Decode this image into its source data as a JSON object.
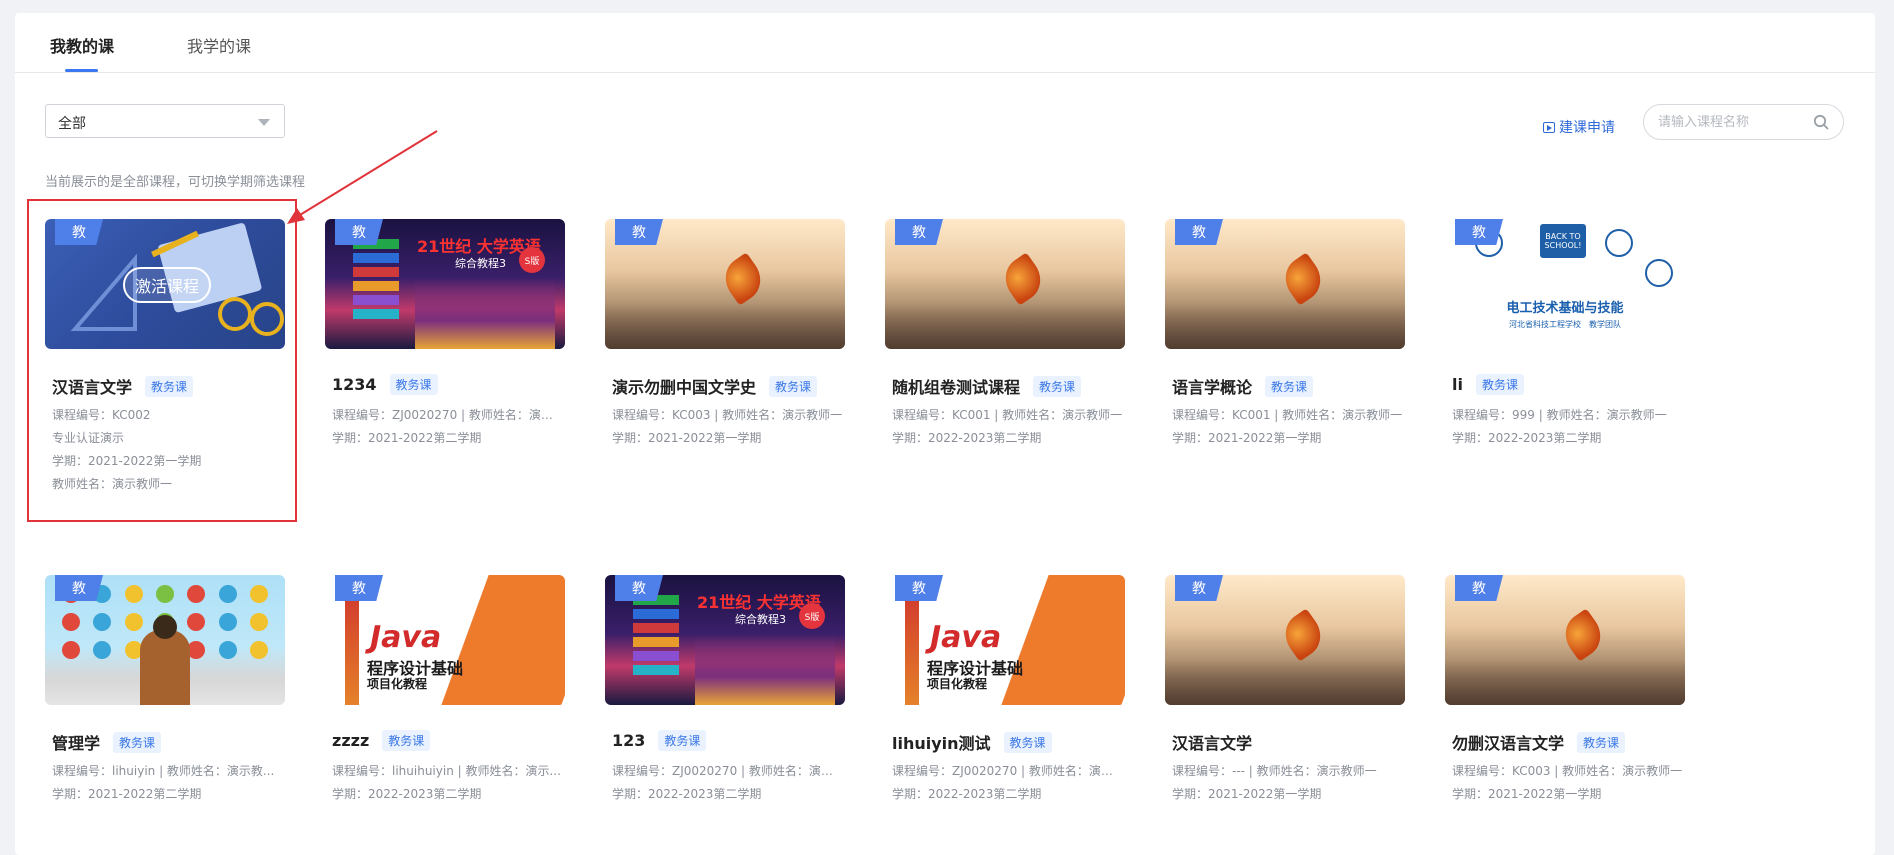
{
  "tabs": [
    {
      "label": "我教的课"
    },
    {
      "label": "我学的课"
    }
  ],
  "filter": {
    "selected": "全部"
  },
  "toolbar": {
    "apply_label": "建课申请"
  },
  "search": {
    "placeholder": "请输入课程名称"
  },
  "hint": "当前展示的是全部课程，可切换学期筛选课程",
  "badge_label": "教",
  "activate_label": "激活课程",
  "colors": {
    "accent": "#3a78f2",
    "badge": "#4f7fe8",
    "tag_text": "#3b78e7",
    "highlight": "#e0333a"
  },
  "courses": [
    {
      "title": "汉语言文学",
      "tag": "教务课",
      "cover": "blue",
      "meta": [
        "课程编号：KC002",
        "专业认证演示",
        "学期：2021-2022第一学期",
        "教师姓名：演示教师一"
      ]
    },
    {
      "title": "1234",
      "tag": "教务课",
      "cover": "city",
      "meta": [
        "课程编号：ZJ0020270 | 教师姓名：演示...",
        "学期：2021-2022第二学期"
      ]
    },
    {
      "title": "演示勿删中国文学史",
      "tag": "教务课",
      "cover": "leaf",
      "meta": [
        "课程编号：KC003 | 教师姓名：演示教师一",
        "学期：2021-2022第一学期"
      ]
    },
    {
      "title": "随机组卷测试课程",
      "tag": "教务课",
      "cover": "leaf",
      "meta": [
        "课程编号：KC001 | 教师姓名：演示教师一",
        "学期：2022-2023第二学期"
      ]
    },
    {
      "title": "语言学概论",
      "tag": "教务课",
      "cover": "leaf",
      "meta": [
        "课程编号：KC001 | 教师姓名：演示教师一",
        "学期：2021-2022第一学期"
      ]
    },
    {
      "title": "li",
      "tag": "教务课",
      "cover": "school",
      "meta": [
        "课程编号：999 | 教师姓名：演示教师一",
        "学期：2022-2023第二学期"
      ]
    },
    {
      "title": "管理学",
      "tag": "教务课",
      "cover": "people",
      "meta": [
        "课程编号：lihuiyin | 教师姓名：演示教...",
        "学期：2021-2022第二学期"
      ]
    },
    {
      "title": "zzzz",
      "tag": "教务课",
      "cover": "java",
      "meta": [
        "课程编号：lihuihuiyin | 教师姓名：演示...",
        "学期：2022-2023第二学期"
      ]
    },
    {
      "title": "123",
      "tag": "教务课",
      "cover": "city",
      "meta": [
        "课程编号：ZJ0020270 | 教师姓名：演示...",
        "学期：2022-2023第二学期"
      ]
    },
    {
      "title": "lihuiyin测试",
      "tag": "教务课",
      "cover": "java",
      "meta": [
        "课程编号：ZJ0020270 | 教师姓名：演示...",
        "学期：2022-2023第二学期"
      ]
    },
    {
      "title": "汉语言文学",
      "tag": "",
      "cover": "leaf",
      "meta": [
        "课程编号：--- | 教师姓名：演示教师一",
        "学期：2021-2022第一学期"
      ]
    },
    {
      "title": "勿删汉语言文学",
      "tag": "教务课",
      "cover": "leaf",
      "meta": [
        "课程编号：KC003 | 教师姓名：演示教师一",
        "学期：2021-2022第一学期"
      ]
    }
  ],
  "cover_texts": {
    "city_title": "21世纪 大学英语",
    "city_sub": "综合教程3",
    "city_badge": "S版",
    "school_title": "电工技术基础与技能",
    "school_sub": "河北省科技工程学校　教学团队",
    "school_sign": "BACK TO SCHOOL!",
    "java_title": "Java",
    "java_sub": "程序设计基础",
    "java_sub2": "项目化教程"
  }
}
